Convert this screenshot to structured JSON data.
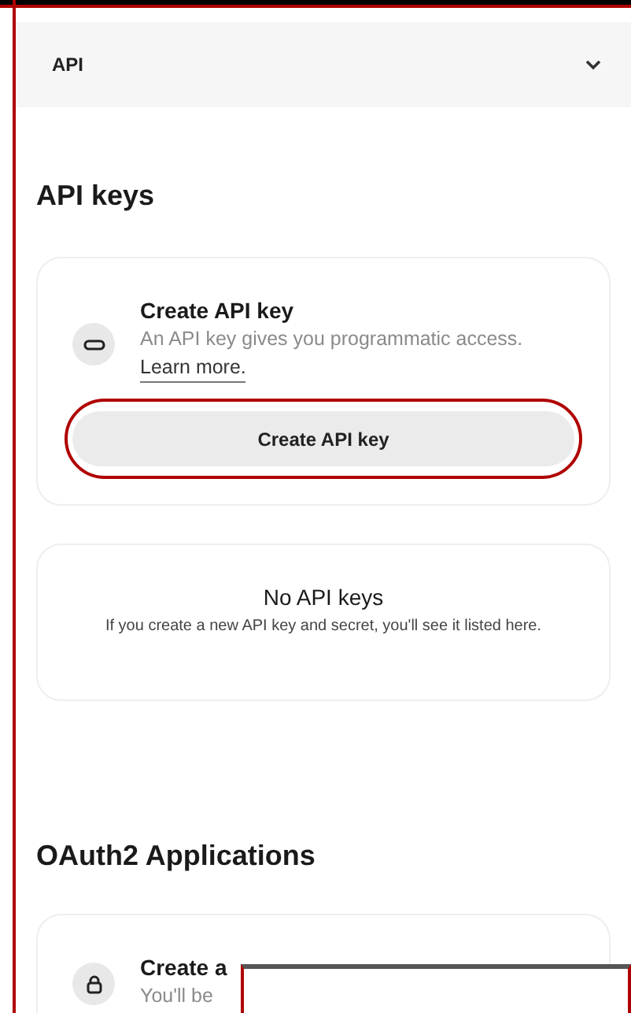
{
  "section_selector": {
    "label": "API",
    "expanded": false
  },
  "api_keys": {
    "heading": "API keys",
    "create_card": {
      "title": "Create API key",
      "description": "An API key gives you programmatic access.",
      "link": "Learn more.",
      "button": "Create API key",
      "highlighted": true
    },
    "empty_state": {
      "title": "No API keys",
      "message": "If you create a new API key and secret, you'll see it listed here."
    }
  },
  "oauth2": {
    "heading": "OAuth2 Applications",
    "create_card": {
      "title": "Create a",
      "description": "You'll be"
    }
  },
  "overlay_panel": {
    "kind": "blank"
  }
}
